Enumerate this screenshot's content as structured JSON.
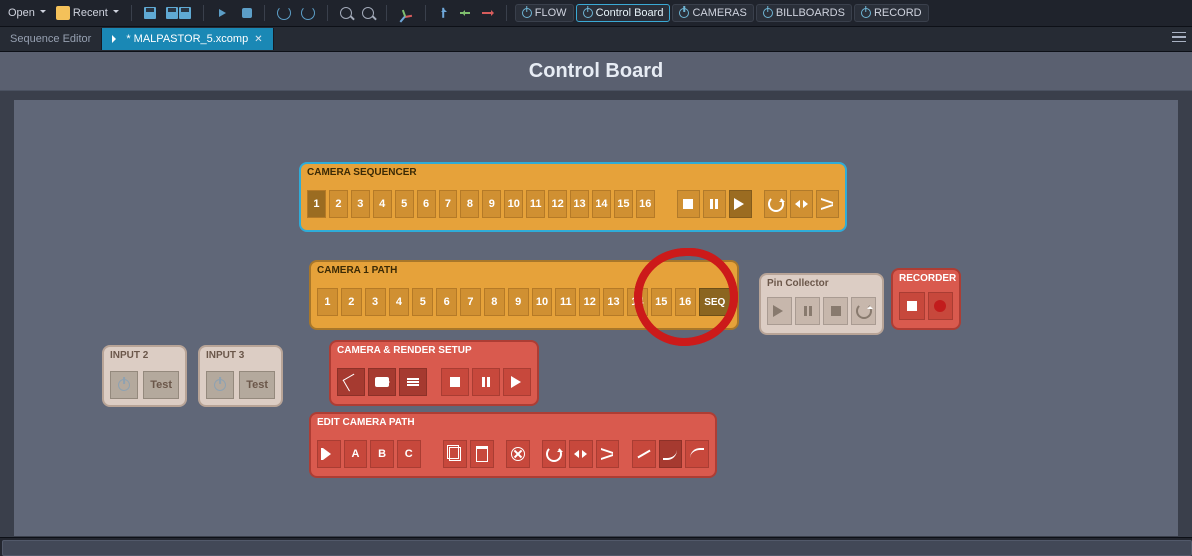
{
  "toolbar": {
    "open": "Open",
    "recent": "Recent",
    "actions": {
      "flow": "FLOW",
      "control_board": "Control Board",
      "cameras": "CAMERAS",
      "billboards": "BILLBOARDS",
      "record": "RECORD"
    }
  },
  "tabs": {
    "seq_editor": "Sequence Editor",
    "file_name": "* MALPASTOR_5.xcomp"
  },
  "page_title": "Control Board",
  "panels": {
    "cam_seq": {
      "title": "CAMERA SEQUENCER",
      "numbers": [
        "1",
        "2",
        "3",
        "4",
        "5",
        "6",
        "7",
        "8",
        "9",
        "10",
        "11",
        "12",
        "13",
        "14",
        "15",
        "16"
      ]
    },
    "cam1_path": {
      "title": "CAMERA 1 PATH",
      "numbers": [
        "1",
        "2",
        "3",
        "4",
        "5",
        "6",
        "7",
        "8",
        "9",
        "10",
        "11",
        "12",
        "13",
        "14",
        "15",
        "16"
      ],
      "seq": "SEQ"
    },
    "pin_collector": {
      "title": "Pin Collector"
    },
    "recorder": {
      "title": "RECORDER"
    },
    "input2": {
      "title": "INPUT 2",
      "test": "Test"
    },
    "input3": {
      "title": "INPUT 3",
      "test": "Test"
    },
    "cam_setup": {
      "title": "CAMERA & RENDER SETUP"
    },
    "edit_path": {
      "title": "EDIT CAMERA PATH",
      "letters": [
        "A",
        "B",
        "C"
      ]
    }
  }
}
